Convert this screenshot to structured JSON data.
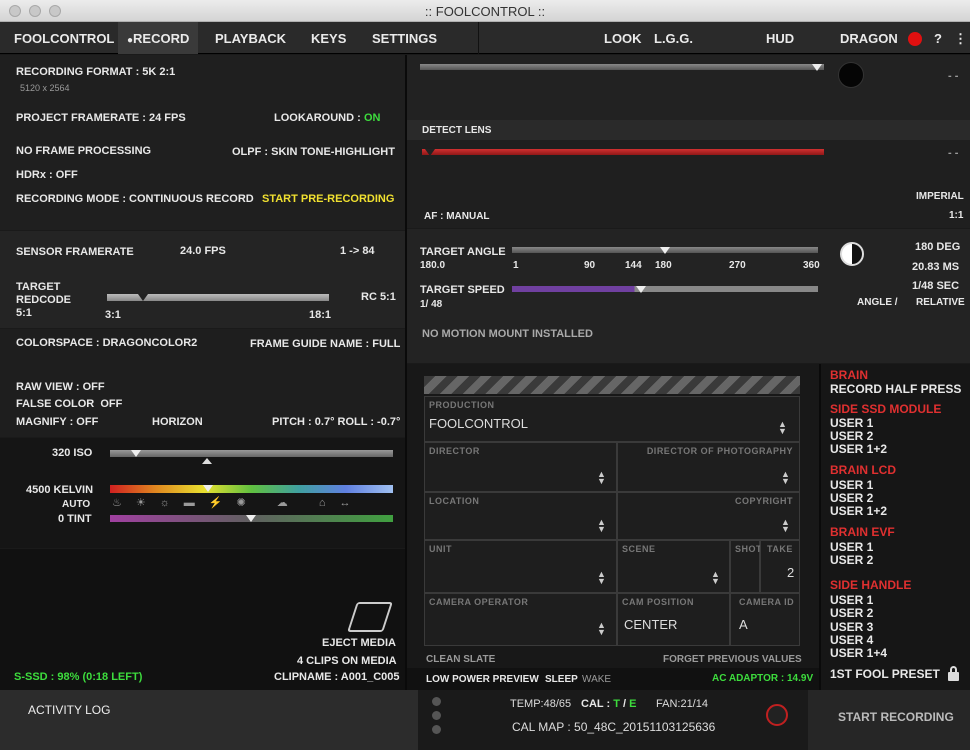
{
  "window": {
    "title": ":: FOOLCONTROL ::"
  },
  "menu": {
    "brand": "FOOLCONTROL",
    "tabs": [
      "RECORD",
      "PLAYBACK",
      "KEYS",
      "SETTINGS"
    ],
    "right": [
      "LOOK",
      "L.G.G.",
      "HUD"
    ],
    "camera": "DRAGON",
    "help": "?",
    "more": "⋮"
  },
  "recording": {
    "format": "RECORDING FORMAT : 5K 2:1",
    "resolution": "5120 x 2564",
    "project_framerate": "PROJECT FRAMERATE : 24 FPS",
    "lookaround_label": "LOOKAROUND :",
    "lookaround_value": "ON",
    "no_frame_processing": "NO FRAME PROCESSING",
    "olpf": "OLPF : SKIN TONE-HIGHLIGHT",
    "hdrx_label": "HDRx :",
    "hdrx_value": "OFF",
    "mode": "RECORDING MODE : CONTINUOUS RECORD",
    "start_pre": "START PRE-RECORDING"
  },
  "sensor": {
    "framerate_label": "SENSOR FRAMERATE",
    "framerate_value": "24.0 FPS",
    "range": "1 -> 84",
    "target_redcode_l1": "TARGET",
    "target_redcode_l2": "REDCODE",
    "target_redcode_l3": "5:1",
    "rc_value": "RC 5:1",
    "rc_min": "3:1",
    "rc_max": "18:1",
    "rc_position": 0.16
  },
  "look": {
    "colorspace": "COLORSPACE : DRAGONCOLOR2",
    "frame_guide": "FRAME GUIDE NAME : FULL",
    "raw_view": "RAW VIEW : OFF",
    "false_color_label": "FALSE COLOR",
    "false_color_value": "OFF",
    "magnify": "MAGNIFY : OFF",
    "horizon": "HORIZON",
    "pitch_roll": "PITCH : 0.7° ROLL : -0.7°"
  },
  "color": {
    "iso": "320 ISO",
    "kelvin": "4500 KELVIN",
    "auto": "AUTO",
    "tint": "0 TINT"
  },
  "media": {
    "eject": "EJECT MEDIA",
    "clips": "4 CLIPS ON MEDIA",
    "clipname": "CLIPNAME : A001_C005",
    "ssd": "S-SSD : 98% (0:18 LEFT)"
  },
  "lens": {
    "detect": "DETECT LENS",
    "dashes1": "- -",
    "dashes2": "- -",
    "imperial": "IMPERIAL",
    "af": "AF : MANUAL",
    "ratio": "1:1"
  },
  "shutter": {
    "angle_label": "TARGET ANGLE",
    "angle_value": "180.0",
    "ticks": [
      "1",
      "90",
      "144",
      "180",
      "270",
      "360"
    ],
    "speed_label": "TARGET SPEED",
    "speed_value": "1/ 48",
    "deg": "180 DEG",
    "ms": "20.83 MS",
    "sec": "1/48 SEC",
    "angle_mode": "ANGLE  /",
    "relative": "RELATIVE",
    "angle_position": 0.5,
    "speed_position": 0.42
  },
  "motion": {
    "text": "NO MOTION MOUNT INSTALLED"
  },
  "slate": {
    "production_label": "PRODUCTION",
    "production_value": "FOOLCONTROL",
    "director_label": "DIRECTOR",
    "dop_label": "DIRECTOR OF PHOTOGRAPHY",
    "location_label": "LOCATION",
    "copyright_label": "COPYRIGHT",
    "unit_label": "UNIT",
    "scene_label": "SCENE",
    "shot_label": "SHOT",
    "take_label": "TAKE",
    "take_value": "2",
    "operator_label": "CAMERA OPERATOR",
    "cam_position_label": "CAM POSITION",
    "cam_position_value": "CENTER",
    "camera_id_label": "CAMERA ID",
    "camera_id_value": "A",
    "clean": "CLEAN SLATE",
    "forget": "FORGET PREVIOUS VALUES"
  },
  "power": {
    "low_power": "LOW POWER PREVIEW",
    "sleep": "SLEEP",
    "wake": "WAKE",
    "adaptor": "AC ADAPTOR : 14.9V"
  },
  "user_keys": {
    "brain": "BRAIN",
    "brain_item": "RECORD HALF PRESS",
    "side_ssd": "SIDE SSD MODULE",
    "side_ssd_items": [
      "USER 1",
      "USER 2",
      "USER 1+2"
    ],
    "brain_lcd": "BRAIN LCD",
    "brain_lcd_items": [
      "USER 1",
      "USER 2",
      "USER 1+2"
    ],
    "brain_evf": "BRAIN EVF",
    "brain_evf_items": [
      "USER 1",
      "USER 2"
    ],
    "side_handle": "SIDE HANDLE",
    "side_handle_items": [
      "USER 1",
      "USER 2",
      "USER 3",
      "USER 4",
      "USER 1+4"
    ],
    "preset": "1ST FOOL PRESET"
  },
  "footer": {
    "activity_log": "ACTIVITY LOG",
    "temp": "TEMP:48/65",
    "cal": "CAL :",
    "cal_t": "T",
    "cal_sep": "/",
    "cal_e": "E",
    "fan": "FAN:21/14",
    "cal_map": "CAL MAP : 50_48C_20151103125636",
    "start_recording": "START RECORDING"
  }
}
